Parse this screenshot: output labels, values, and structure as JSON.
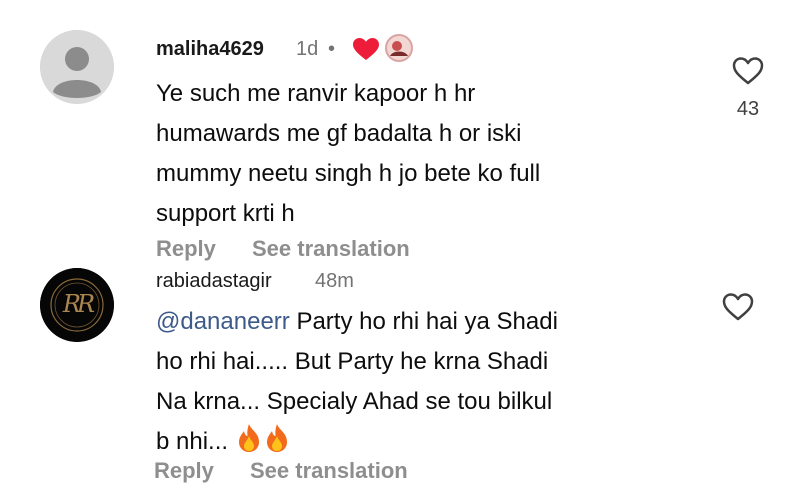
{
  "comments": [
    {
      "username": "maliha4629",
      "time": "1d",
      "separator": "•",
      "body_lines": [
        "Ye such me ranvir kapoor h hr",
        "humawards me gf badalta h or iski",
        "mummy neetu singh h jo bete ko full",
        "support krti h"
      ],
      "reply_label": "Reply",
      "translate_label": "See translation",
      "like_count": "43",
      "avatar": "default-user-avatar",
      "reactions": [
        "red-heart-icon",
        "creator-avatar-icon"
      ]
    },
    {
      "username": "rabiadastagir",
      "time": "48m",
      "avatar_monogram": "RR",
      "mention": "@dananeerr",
      "body_first": " Party ho rhi hai ya Shadi",
      "body_lines": [
        "ho rhi hai..... But Party he krna Shadi",
        "Na krna... Specialy Ahad se tou bilkul",
        "b nhi..."
      ],
      "emoji": [
        "fire-emoji",
        "fire-emoji"
      ],
      "reply_label": "Reply",
      "translate_label": "See translation"
    }
  ],
  "colors": {
    "username": "#1a1a1a",
    "meta_gray": "#737373",
    "action_gray": "#8e8e8e",
    "mention_blue": "#3d5a8a",
    "heart_red": "#ed1c3a"
  }
}
